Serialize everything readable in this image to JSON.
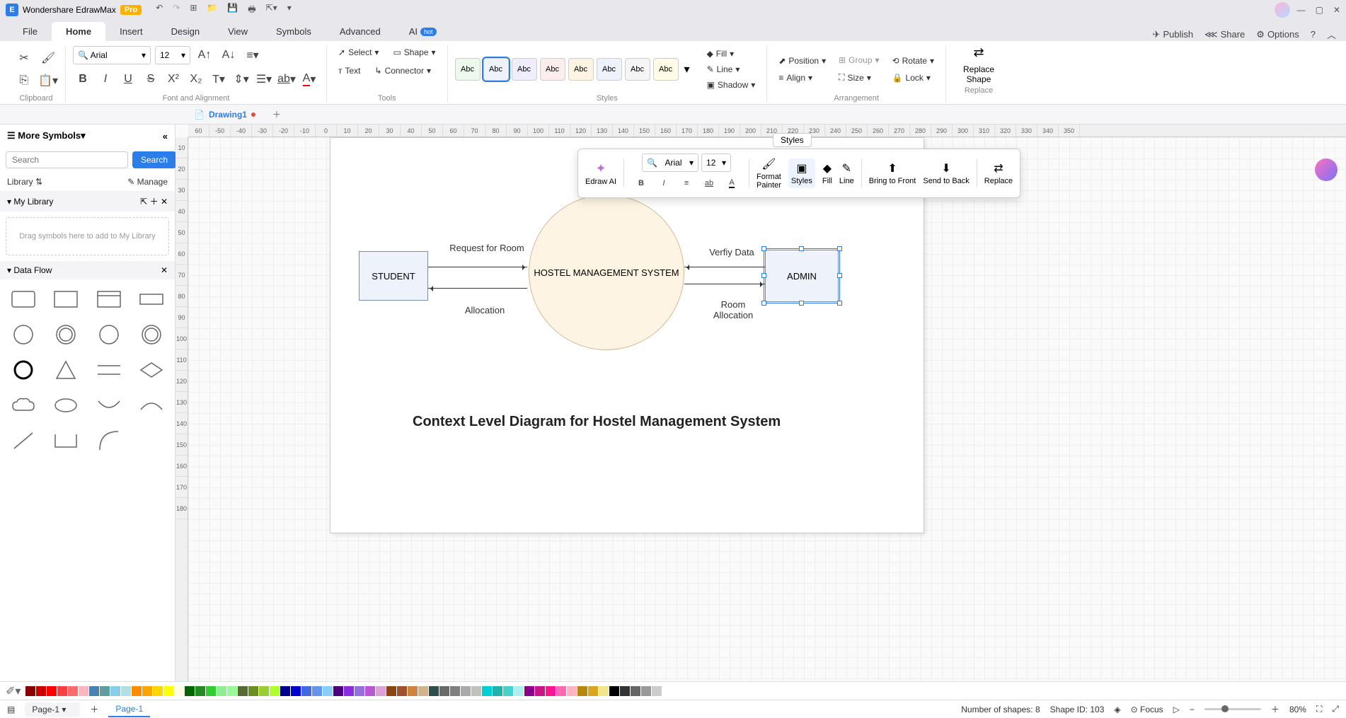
{
  "title_bar": {
    "app_name": "Wondershare EdrawMax",
    "pro": "Pro"
  },
  "menu": {
    "file": "File",
    "home": "Home",
    "insert": "Insert",
    "design": "Design",
    "view": "View",
    "symbols": "Symbols",
    "advanced": "Advanced",
    "ai": "AI",
    "hot": "hot",
    "publish": "Publish",
    "share": "Share",
    "options": "Options"
  },
  "ribbon": {
    "clipboard": "Clipboard",
    "font_align": "Font and Alignment",
    "tools": "Tools",
    "styles": "Styles",
    "arrangement": "Arrangement",
    "replace": "Replace",
    "font_name": "Arial",
    "font_size": "12",
    "select": "Select",
    "shape": "Shape",
    "text": "Text",
    "connector": "Connector",
    "abc": "Abc",
    "fill": "Fill",
    "line": "Line",
    "shadow": "Shadow",
    "position": "Position",
    "align": "Align",
    "group": "Group",
    "size": "Size",
    "rotate": "Rotate",
    "lock": "Lock",
    "replace_shape": "Replace\nShape"
  },
  "doc": {
    "drawing": "Drawing1"
  },
  "left": {
    "more_symbols": "More Symbols",
    "search_ph": "Search",
    "search_btn": "Search",
    "library": "Library",
    "manage": "Manage",
    "my_library": "My Library",
    "drop_hint": "Drag symbols here to add to My Library",
    "data_flow": "Data Flow"
  },
  "float": {
    "styles_label": "Styles",
    "font": "Arial",
    "size": "12",
    "edraw_ai": "Edraw AI",
    "format_painter": "Format\nPainter",
    "styles": "Styles",
    "fill": "Fill",
    "line": "Line",
    "bring_front": "Bring to Front",
    "send_back": "Send to Back",
    "replace": "Replace"
  },
  "diagram": {
    "student": "STUDENT",
    "system": "HOSTEL MANAGEMENT SYSTEM",
    "admin": "ADMIN",
    "req_room": "Request for Room",
    "allocation": "Allocation",
    "verify": "Verfiy Data",
    "room_alloc": "Room Allocation",
    "title": "Context Level Diagram for Hostel Management System"
  },
  "status": {
    "page_sel": "Page-1",
    "page_tab": "Page-1",
    "shapes_count": "Number of shapes: 8",
    "shape_id": "Shape ID: 103",
    "focus": "Focus",
    "zoom": "80%"
  },
  "ruler_h": [
    "60",
    "-50",
    "-40",
    "-30",
    "-20",
    "-10",
    "0",
    "10",
    "20",
    "30",
    "40",
    "50",
    "60",
    "70",
    "80",
    "90",
    "100",
    "110",
    "120",
    "130",
    "140",
    "150",
    "160",
    "170",
    "180",
    "190",
    "200",
    "210",
    "220",
    "230",
    "240",
    "250",
    "260",
    "270",
    "280",
    "290",
    "300",
    "310",
    "320",
    "330",
    "340",
    "350"
  ],
  "ruler_v": [
    "10",
    "20",
    "30",
    "40",
    "50",
    "60",
    "70",
    "80",
    "90",
    "100",
    "110",
    "120",
    "130",
    "140",
    "150",
    "160",
    "170",
    "180"
  ],
  "colors": [
    "#8b0000",
    "#cd0000",
    "#ff0000",
    "#ff4040",
    "#ff6a6a",
    "#ffb6c1",
    "#4682b4",
    "#5f9ea0",
    "#87ceeb",
    "#b0e0e6",
    "#ff8c00",
    "#ffa500",
    "#ffd700",
    "#ffff00",
    "#ffffe0",
    "#006400",
    "#228b22",
    "#32cd32",
    "#90ee90",
    "#98fb98",
    "#556b2f",
    "#6b8e23",
    "#9acd32",
    "#adff2f",
    "#00008b",
    "#0000cd",
    "#4169e1",
    "#6495ed",
    "#87cefa",
    "#4b0082",
    "#8a2be2",
    "#9370db",
    "#ba55d3",
    "#dda0dd",
    "#8b4513",
    "#a0522d",
    "#cd853f",
    "#d2b48c",
    "#2f4f4f",
    "#696969",
    "#808080",
    "#a9a9a9",
    "#c0c0c0",
    "#00ced1",
    "#20b2aa",
    "#48d1cc",
    "#afeeee",
    "#8b008b",
    "#c71585",
    "#ff1493",
    "#ff69b4",
    "#ffb6c1",
    "#b8860b",
    "#daa520",
    "#f0e68c",
    "#000000",
    "#333333",
    "#666666",
    "#999999",
    "#cccccc"
  ]
}
